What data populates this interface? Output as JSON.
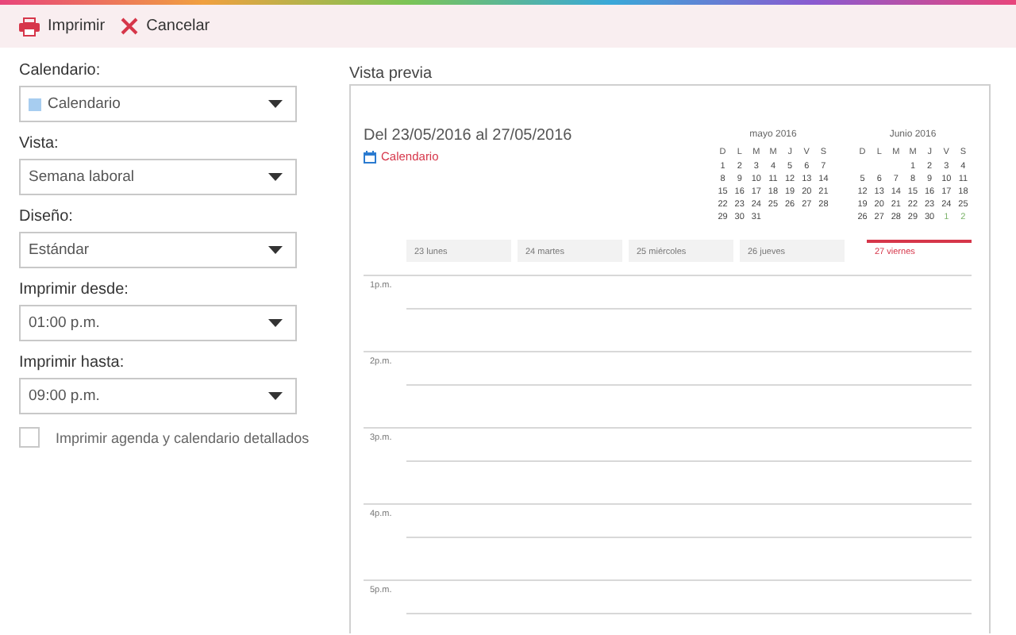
{
  "toolbar": {
    "buttons": [
      {
        "kind": "print",
        "label": "Imprimir"
      },
      {
        "kind": "cancel",
        "label": "Cancelar"
      }
    ]
  },
  "options": {
    "fields": [
      {
        "label": "Calendario:",
        "value": "Calendario",
        "color": "#a7cdf0"
      },
      {
        "label": "Vista:",
        "value": "Semana laboral"
      },
      {
        "label": "Diseño:",
        "value": "Estándar"
      },
      {
        "label": "Imprimir desde:",
        "value": "01:00 p.m."
      },
      {
        "label": "Imprimir hasta:",
        "value": "09:00 p.m."
      }
    ],
    "checkbox": {
      "label": "Imprimir agenda y calendario detallados",
      "checked": false
    }
  },
  "preview": {
    "label": "Vista previa",
    "range": "Del 23/05/2016 al 27/05/2016",
    "calendar_name": "Calendario",
    "mini_calendars": [
      {
        "title": "mayo 2016",
        "weekdays": [
          "D",
          "L",
          "M",
          "M",
          "J",
          "V",
          "S"
        ],
        "weeks": [
          [
            {
              "d": "1",
              "other": false
            },
            {
              "d": "2",
              "other": false
            },
            {
              "d": "3",
              "other": false
            },
            {
              "d": "4",
              "other": false
            },
            {
              "d": "5",
              "other": false
            },
            {
              "d": "6",
              "other": false
            },
            {
              "d": "7",
              "other": false
            }
          ],
          [
            {
              "d": "8",
              "other": false
            },
            {
              "d": "9",
              "other": false
            },
            {
              "d": "10",
              "other": false
            },
            {
              "d": "11",
              "other": false
            },
            {
              "d": "12",
              "other": false
            },
            {
              "d": "13",
              "other": false
            },
            {
              "d": "14",
              "other": false
            }
          ],
          [
            {
              "d": "15",
              "other": false
            },
            {
              "d": "16",
              "other": false
            },
            {
              "d": "17",
              "other": false
            },
            {
              "d": "18",
              "other": false
            },
            {
              "d": "19",
              "other": false
            },
            {
              "d": "20",
              "other": false
            },
            {
              "d": "21",
              "other": false
            }
          ],
          [
            {
              "d": "22",
              "other": false
            },
            {
              "d": "23",
              "other": false
            },
            {
              "d": "24",
              "other": false
            },
            {
              "d": "25",
              "other": false
            },
            {
              "d": "26",
              "other": false
            },
            {
              "d": "27",
              "other": false
            },
            {
              "d": "28",
              "other": false
            }
          ],
          [
            {
              "d": "29",
              "other": false
            },
            {
              "d": "30",
              "other": false
            },
            {
              "d": "31",
              "other": false
            }
          ]
        ]
      },
      {
        "title": "Junio 2016",
        "weekdays": [
          "D",
          "L",
          "M",
          "M",
          "J",
          "V",
          "S"
        ],
        "weeks": [
          [
            {
              "d": "1",
              "other": false
            },
            {
              "d": "2",
              "other": false
            },
            {
              "d": "3",
              "other": false
            },
            {
              "d": "4",
              "other": false
            }
          ],
          [
            {
              "d": "5",
              "other": false
            },
            {
              "d": "6",
              "other": false
            },
            {
              "d": "7",
              "other": false
            },
            {
              "d": "8",
              "other": false
            },
            {
              "d": "9",
              "other": false
            },
            {
              "d": "10",
              "other": false
            },
            {
              "d": "11",
              "other": false
            }
          ],
          [
            {
              "d": "12",
              "other": false
            },
            {
              "d": "13",
              "other": false
            },
            {
              "d": "14",
              "other": false
            },
            {
              "d": "15",
              "other": false
            },
            {
              "d": "16",
              "other": false
            },
            {
              "d": "17",
              "other": false
            },
            {
              "d": "18",
              "other": false
            }
          ],
          [
            {
              "d": "19",
              "other": false
            },
            {
              "d": "20",
              "other": false
            },
            {
              "d": "21",
              "other": false
            },
            {
              "d": "22",
              "other": false
            },
            {
              "d": "23",
              "other": false
            },
            {
              "d": "24",
              "other": false
            },
            {
              "d": "25",
              "other": false
            }
          ],
          [
            {
              "d": "26",
              "other": false
            },
            {
              "d": "27",
              "other": false
            },
            {
              "d": "28",
              "other": false
            },
            {
              "d": "29",
              "other": false
            },
            {
              "d": "30",
              "other": false
            },
            {
              "d": "1",
              "other": true
            },
            {
              "d": "2",
              "other": true
            }
          ]
        ]
      }
    ],
    "days": [
      {
        "label": "23 lunes",
        "selected": false
      },
      {
        "label": "24 martes",
        "selected": false
      },
      {
        "label": "25 miércoles",
        "selected": false
      },
      {
        "label": "26 jueves",
        "selected": false
      },
      {
        "label": "27 viernes",
        "selected": true
      }
    ],
    "hours": [
      "1p.m.",
      "2p.m.",
      "3p.m.",
      "4p.m.",
      "5p.m."
    ]
  }
}
